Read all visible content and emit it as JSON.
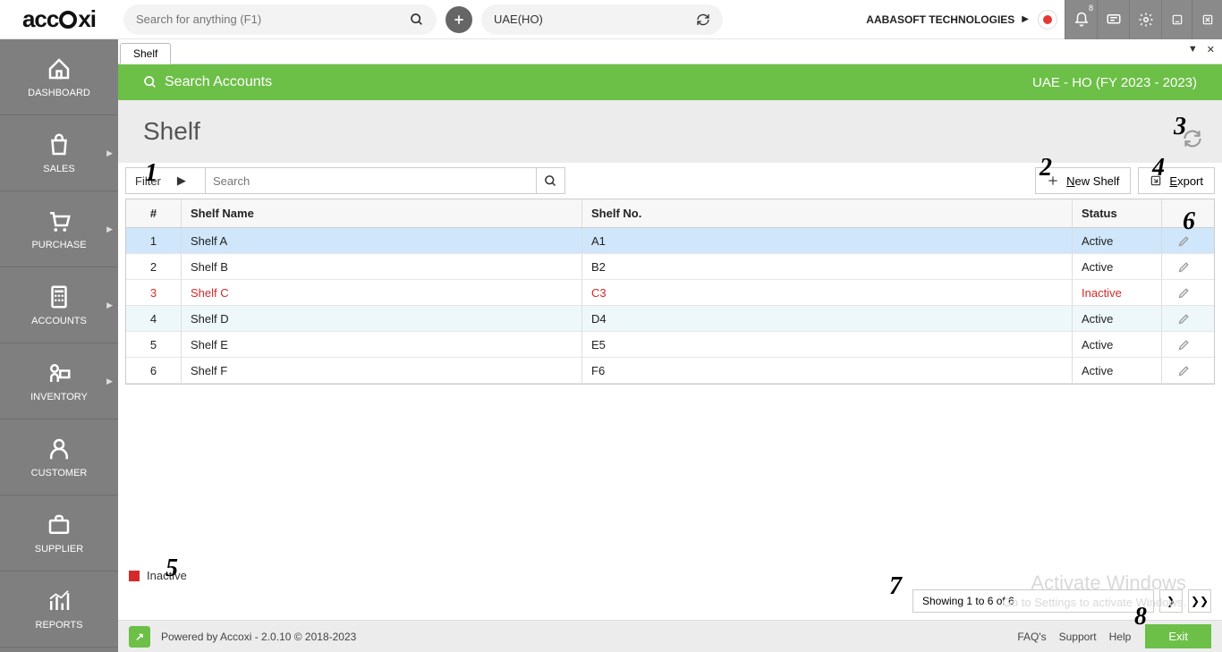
{
  "top": {
    "logo_a": "acc",
    "logo_b": "o",
    "logo_c": "xi",
    "search_placeholder": "Search for anything (F1)",
    "location": "UAE(HO)",
    "company": "AABASOFT TECHNOLOGIES",
    "notif_badge": "8"
  },
  "sidebar": [
    {
      "label": "DASHBOARD",
      "icon": "home"
    },
    {
      "label": "SALES",
      "icon": "bag",
      "sub": true
    },
    {
      "label": "PURCHASE",
      "icon": "cart",
      "sub": true
    },
    {
      "label": "ACCOUNTS",
      "icon": "calc",
      "sub": true
    },
    {
      "label": "INVENTORY",
      "icon": "inv",
      "sub": true
    },
    {
      "label": "CUSTOMER",
      "icon": "user"
    },
    {
      "label": "SUPPLIER",
      "icon": "brief"
    },
    {
      "label": "REPORTS",
      "icon": "chart"
    }
  ],
  "tab_label": "Shelf",
  "greenbar": {
    "search": "Search Accounts",
    "context": "UAE - HO (FY 2023 - 2023)"
  },
  "page_title": "Shelf",
  "filter": {
    "label": "Filter",
    "search_placeholder": "Search"
  },
  "actions": {
    "new": "New Shelf",
    "export": "Export"
  },
  "table": {
    "headers": {
      "n": "#",
      "name": "Shelf Name",
      "no": "Shelf No.",
      "status": "Status"
    },
    "rows": [
      {
        "n": "1",
        "name": "Shelf A",
        "no": "A1",
        "status": "Active",
        "state": "selected"
      },
      {
        "n": "2",
        "name": "Shelf B",
        "no": "B2",
        "status": "Active",
        "state": ""
      },
      {
        "n": "3",
        "name": "Shelf C",
        "no": "C3",
        "status": "Inactive",
        "state": "inactive"
      },
      {
        "n": "4",
        "name": "Shelf D",
        "no": "D4",
        "status": "Active",
        "state": "alt"
      },
      {
        "n": "5",
        "name": "Shelf E",
        "no": "E5",
        "status": "Active",
        "state": ""
      },
      {
        "n": "6",
        "name": "Shelf F",
        "no": "F6",
        "status": "Active",
        "state": ""
      }
    ]
  },
  "legend": "Inactive",
  "pager": {
    "info": "Showing 1 to 6 of 6"
  },
  "footer": {
    "powered": "Powered by Accoxi - 2.0.10 © 2018-2023",
    "faq": "FAQ's",
    "support": "Support",
    "help": "Help",
    "exit": "Exit"
  },
  "watermark": {
    "l1": "Activate Windows",
    "l2": "Go to Settings to activate Windows."
  },
  "callouts": {
    "c1": "1",
    "c2": "2",
    "c3": "3",
    "c4": "4",
    "c5": "5",
    "c6": "6",
    "c7": "7",
    "c8": "8"
  }
}
